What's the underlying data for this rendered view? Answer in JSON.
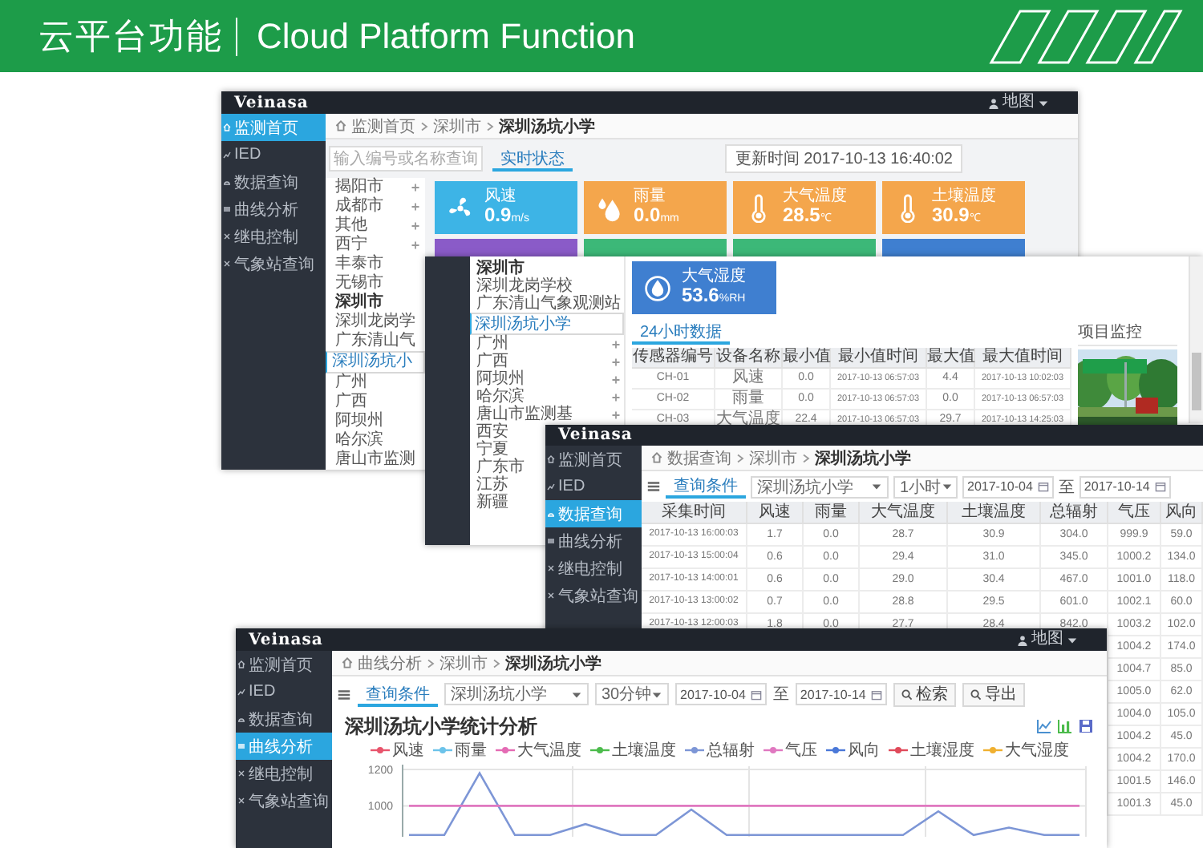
{
  "banner": {
    "title_cn": "云平台功能",
    "title_en": "Cloud Platform Function"
  },
  "realtime_window": {
    "brand": "Veinasa",
    "user": "地图",
    "nav": [
      {
        "label": "监测首页",
        "selected": true
      },
      {
        "label": "IED",
        "selected": false
      },
      {
        "label": "数据查询",
        "selected": false
      },
      {
        "label": "曲线分析",
        "selected": false
      },
      {
        "label": "继电控制",
        "selected": false
      },
      {
        "label": "气象站查询",
        "selected": false
      }
    ],
    "breadcrumb": [
      "监测首页",
      "深圳市",
      "深圳汤坑小学"
    ],
    "search": {
      "placeholder": "输入编号或名称查询"
    },
    "tab": {
      "label": "实时状态",
      "selected": true
    },
    "update_time": "更新时间 2017-10-13 16:40:02",
    "sites": [
      {
        "name": "揭阳市",
        "expandable": true,
        "bold": false,
        "selected": false
      },
      {
        "name": "成都市",
        "expandable": true,
        "bold": false,
        "selected": false
      },
      {
        "name": "其他",
        "expandable": true,
        "bold": false,
        "selected": false
      },
      {
        "name": "西宁",
        "expandable": true,
        "bold": false,
        "selected": false
      },
      {
        "name": "丰泰市",
        "expandable": false,
        "bold": false,
        "selected": false
      },
      {
        "name": "无锡市",
        "expandable": false,
        "bold": false,
        "selected": false
      },
      {
        "name": "深圳市",
        "expandable": false,
        "bold": true,
        "selected": false
      },
      {
        "name": "深圳龙岗学",
        "expandable": false,
        "bold": false,
        "selected": false
      },
      {
        "name": "广东清山气",
        "expandable": false,
        "bold": false,
        "selected": false
      },
      {
        "name": "深圳汤坑小",
        "expandable": false,
        "bold": false,
        "selected": true
      },
      {
        "name": "广州",
        "expandable": false,
        "bold": false,
        "selected": false
      },
      {
        "name": "广西",
        "expandable": false,
        "bold": false,
        "selected": false
      },
      {
        "name": "阿坝州",
        "expandable": false,
        "bold": false,
        "selected": false
      },
      {
        "name": "哈尔滨",
        "expandable": false,
        "bold": false,
        "selected": false
      },
      {
        "name": "唐山市监测",
        "expandable": false,
        "bold": false,
        "selected": false
      }
    ],
    "cards": [
      {
        "label": "风速",
        "value": "0.9",
        "unit": "m/s",
        "color": "#3db4e6"
      },
      {
        "label": "雨量",
        "value": "0.0",
        "unit": "mm",
        "color": "#f4a64c"
      },
      {
        "label": "大气温度",
        "value": "28.5",
        "unit": "℃",
        "color": "#f4a64c"
      },
      {
        "label": "土壤温度",
        "value": "30.9",
        "unit": "℃",
        "color": "#f4a64c"
      }
    ],
    "more_cards": [
      {
        "color": "#8a5bc8"
      },
      {
        "color": "#3cb878"
      },
      {
        "color": "#3cb878"
      },
      {
        "color": "#3f7fd0"
      }
    ]
  },
  "detail_window": {
    "sites": [
      {
        "name": "深圳市",
        "expandable": false,
        "bold": true,
        "selected": false
      },
      {
        "name": "深圳龙岗学校",
        "expandable": false,
        "bold": false,
        "selected": false
      },
      {
        "name": "广东清山气象观测站",
        "expandable": false,
        "bold": false,
        "selected": false
      },
      {
        "name": "深圳汤坑小学",
        "expandable": false,
        "bold": false,
        "selected": true
      },
      {
        "name": "广州",
        "expandable": true,
        "bold": false,
        "selected": false
      },
      {
        "name": "广西",
        "expandable": true,
        "bold": false,
        "selected": false
      },
      {
        "name": "阿坝州",
        "expandable": true,
        "bold": false,
        "selected": false
      },
      {
        "name": "哈尔滨",
        "expandable": true,
        "bold": false,
        "selected": false
      },
      {
        "name": "唐山市监测基",
        "expandable": true,
        "bold": false,
        "selected": false
      },
      {
        "name": "西安",
        "expandable": false,
        "bold": false,
        "selected": false
      },
      {
        "name": "宁夏",
        "expandable": false,
        "bold": false,
        "selected": false
      },
      {
        "name": "广东市",
        "expandable": false,
        "bold": false,
        "selected": false
      },
      {
        "name": "江苏",
        "expandable": false,
        "bold": false,
        "selected": false
      },
      {
        "name": "新疆",
        "expandable": false,
        "bold": false,
        "selected": false
      }
    ],
    "card": {
      "label": "大气湿度",
      "value": "53.6",
      "unit": "%RH",
      "color": "#3f7fd0"
    },
    "tab": {
      "label": "24小时数据",
      "selected": true
    },
    "table": {
      "columns": [
        "传感器编号",
        "设备名称",
        "最小值",
        "最小值时间",
        "最大值",
        "最大值时间"
      ],
      "rows": [
        [
          "CH-01",
          "风速",
          "0.0",
          "2017-10-13 06:57:03",
          "4.4",
          "2017-10-13 10:02:03"
        ],
        [
          "CH-02",
          "雨量",
          "0.0",
          "2017-10-13 06:57:03",
          "0.0",
          "2017-10-13 06:57:03"
        ],
        [
          "CH-03",
          "大气温度",
          "22.4",
          "2017-10-13 06:57:03",
          "29.7",
          "2017-10-13 14:25:03"
        ]
      ]
    },
    "panel": {
      "title": "项目监控"
    }
  },
  "query_window": {
    "brand": "Veinasa",
    "nav": [
      {
        "label": "监测首页",
        "selected": false
      },
      {
        "label": "IED",
        "selected": false
      },
      {
        "label": "数据查询",
        "selected": true
      },
      {
        "label": "曲线分析",
        "selected": false
      },
      {
        "label": "继电控制",
        "selected": false
      },
      {
        "label": "气象站查询",
        "selected": false
      }
    ],
    "breadcrumb": [
      "数据查询",
      "深圳市",
      "深圳汤坑小学"
    ],
    "filter": {
      "tab": "查询条件",
      "site": "深圳汤坑小学",
      "interval": "1小时",
      "date_from": "2017-10-04",
      "date_sep": "至",
      "date_to": "2017-10-14"
    },
    "table": {
      "columns": [
        "采集时间",
        "风速",
        "雨量",
        "大气温度",
        "土壤温度",
        "总辐射",
        "气压",
        "风向"
      ],
      "rows": [
        {
          "cells": [
            "2017-10-13 16:00:03",
            "1.7",
            "0.0",
            "28.7",
            "30.9",
            "304.0",
            "999.9",
            "59.0"
          ]
        },
        {
          "cells": [
            "2017-10-13 15:00:04",
            "0.6",
            "0.0",
            "29.4",
            "31.0",
            "345.0",
            "1000.2",
            "134.0"
          ]
        },
        {
          "cells": [
            "2017-10-13 14:00:01",
            "0.6",
            "0.0",
            "29.0",
            "30.4",
            "467.0",
            "1001.0",
            "118.0"
          ]
        },
        {
          "cells": [
            "2017-10-13 13:00:02",
            "0.7",
            "0.0",
            "28.8",
            "29.5",
            "601.0",
            "1002.1",
            "60.0"
          ]
        },
        {
          "cells": [
            "2017-10-13 12:00:03",
            "1.8",
            "0.0",
            "27.7",
            "28.4",
            "842.0",
            "1003.2",
            "102.0"
          ]
        },
        {
          "tail": [
            "1004.2",
            "174.0"
          ]
        },
        {
          "tail": [
            "1004.7",
            "85.0"
          ]
        },
        {
          "tail": [
            "1005.0",
            "62.0"
          ]
        },
        {
          "tail": [
            "1004.0",
            "105.0"
          ]
        },
        {
          "tail": [
            "1004.2",
            "45.0"
          ]
        },
        {
          "tail": [
            "1004.2",
            "170.0"
          ]
        },
        {
          "tail": [
            "1001.5",
            "146.0"
          ]
        },
        {
          "tail": [
            "1001.3",
            "45.0"
          ]
        }
      ]
    }
  },
  "analysis_window": {
    "brand": "Veinasa",
    "user": "地图",
    "nav": [
      {
        "label": "监测首页",
        "selected": false
      },
      {
        "label": "IED",
        "selected": false
      },
      {
        "label": "数据查询",
        "selected": false
      },
      {
        "label": "曲线分析",
        "selected": true
      },
      {
        "label": "继电控制",
        "selected": false
      },
      {
        "label": "气象站查询",
        "selected": false
      }
    ],
    "breadcrumb": [
      "曲线分析",
      "深圳市",
      "深圳汤坑小学"
    ],
    "filter": {
      "tab": "查询条件",
      "site": "深圳汤坑小学",
      "interval": "30分钟",
      "date_from": "2017-10-04",
      "date_sep": "至",
      "date_to": "2017-10-14",
      "search_button": "检索",
      "export_button": "导出"
    },
    "title": "深圳汤坑小学统计分析",
    "chart_data": {
      "type": "line",
      "ylim": [
        830,
        1200
      ],
      "yticks": [
        1000,
        1200
      ],
      "series": [
        {
          "name": "风速",
          "color": "#e8546c",
          "values": [
            null,
            null,
            null,
            null,
            null,
            null,
            null,
            null,
            null,
            null,
            null,
            null,
            null,
            null,
            null,
            null,
            null,
            null,
            null,
            null
          ]
        },
        {
          "name": "雨量",
          "color": "#6cc3ea",
          "values": [
            null,
            null,
            null,
            null,
            null,
            null,
            null,
            null,
            null,
            null,
            null,
            null,
            null,
            null,
            null,
            null,
            null,
            null,
            null,
            null
          ]
        },
        {
          "name": "大气温度",
          "color": "#e46bb4",
          "values": [
            null,
            null,
            null,
            null,
            null,
            null,
            null,
            null,
            null,
            null,
            null,
            null,
            null,
            null,
            null,
            null,
            null,
            null,
            null,
            null
          ]
        },
        {
          "name": "土壤温度",
          "color": "#4cbb4c",
          "values": [
            null,
            null,
            null,
            null,
            null,
            null,
            null,
            null,
            null,
            null,
            null,
            null,
            null,
            null,
            null,
            null,
            null,
            null,
            null,
            null
          ]
        },
        {
          "name": "总辐射",
          "color": "#7d96d6",
          "values": [
            840,
            840,
            1180,
            840,
            840,
            900,
            840,
            840,
            980,
            840,
            840,
            840,
            840,
            840,
            840,
            970,
            840,
            880,
            840,
            840
          ]
        },
        {
          "name": "气压",
          "color": "#e078c0",
          "values": [
            1000,
            1000,
            1000,
            1000,
            1000,
            1000,
            1000,
            1000,
            1000,
            1000,
            1000,
            1000,
            1000,
            1000,
            1000,
            1000,
            1000,
            1000,
            1000,
            1000
          ]
        },
        {
          "name": "风向",
          "color": "#4a78d8",
          "values": [
            null,
            null,
            null,
            null,
            null,
            null,
            null,
            null,
            null,
            null,
            null,
            null,
            null,
            null,
            null,
            null,
            null,
            null,
            null,
            null
          ]
        },
        {
          "name": "土壤湿度",
          "color": "#e04a5a",
          "values": [
            null,
            null,
            null,
            null,
            null,
            null,
            null,
            null,
            null,
            null,
            null,
            null,
            null,
            null,
            null,
            null,
            null,
            null,
            null,
            null
          ]
        },
        {
          "name": "大气湿度",
          "color": "#f0b030",
          "values": [
            null,
            null,
            null,
            null,
            null,
            null,
            null,
            null,
            null,
            null,
            null,
            null,
            null,
            null,
            null,
            null,
            null,
            null,
            null,
            null
          ]
        }
      ]
    }
  }
}
